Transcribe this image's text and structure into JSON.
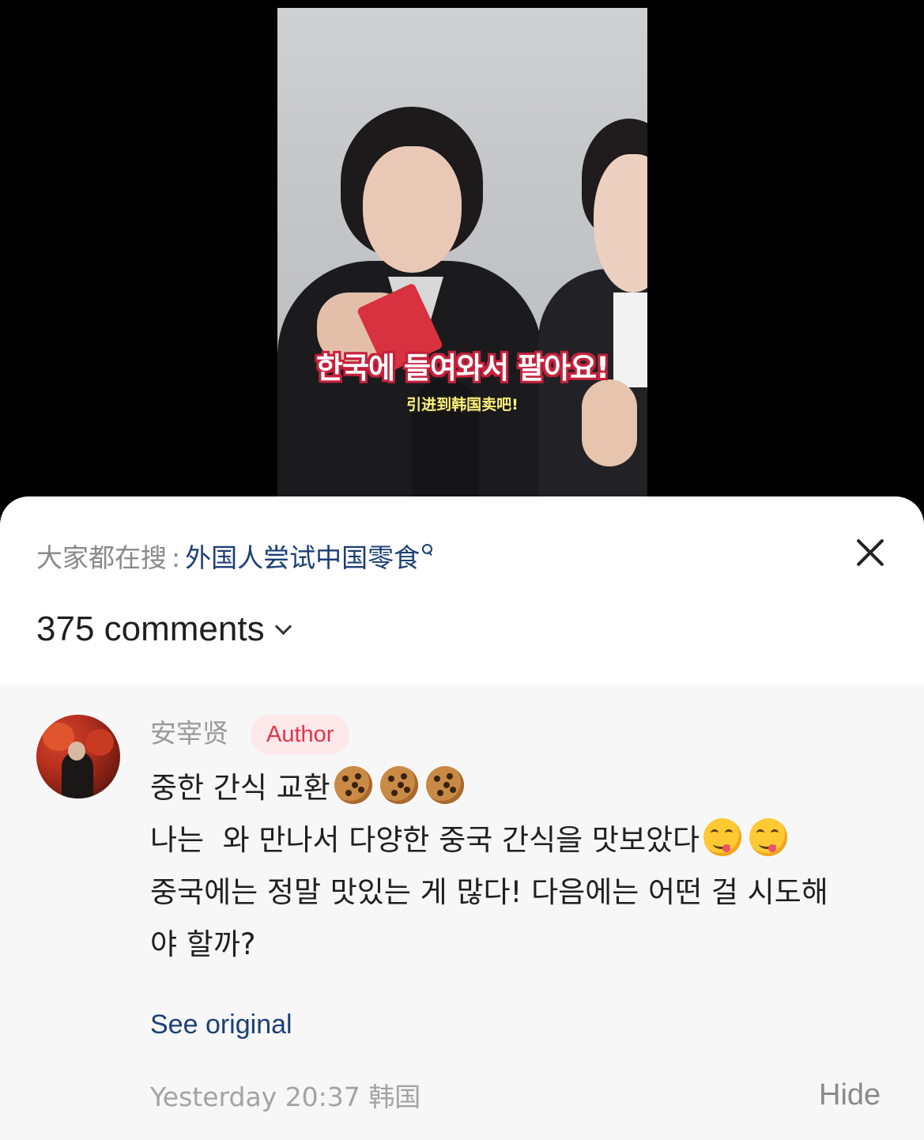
{
  "video": {
    "subtitle_korean": "한국에 들여와서 팔아요!",
    "subtitle_chinese": "引进到韩国卖吧!"
  },
  "search": {
    "prefix": "大家都在搜",
    "separator": ":",
    "term": "外国人尝试中国零食"
  },
  "comments": {
    "count_label": "375 comments"
  },
  "comment": {
    "username": "安宰贤",
    "badge": "Author",
    "line1": "중한 간식 교환",
    "line2_a": "나는",
    "line2_b": "와 만나서 다양한 중국 간식을 맛보았다",
    "line3": "중국에는 정말 맛있는 게 많다! 다음에는 어떤 걸 시도해",
    "line4": "야 할까?",
    "see_original": "See original",
    "timestamp": "Yesterday 20:37 韩国",
    "hide_label": "Hide"
  },
  "colors": {
    "link_blue": "#1c3f75",
    "badge_red": "#e6334a",
    "badge_bg": "#fde8ea",
    "comment_bg": "#f7f7f7"
  }
}
